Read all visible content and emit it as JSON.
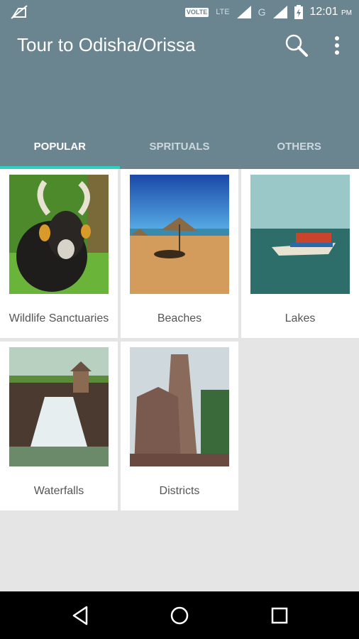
{
  "status_bar": {
    "volte": "VOLTE",
    "lte": "LTE",
    "network": "G",
    "time": "12:01",
    "ampm": "PM"
  },
  "app_bar": {
    "title": "Tour to Odisha/Orissa"
  },
  "tabs": [
    {
      "label": "POPULAR",
      "active": true
    },
    {
      "label": "SPRITUALS",
      "active": false
    },
    {
      "label": "OTHERS",
      "active": false
    }
  ],
  "categories": [
    {
      "label": "Wildlife Sanctuaries",
      "image": "bison-image"
    },
    {
      "label": "Beaches",
      "image": "beach-image"
    },
    {
      "label": "Lakes",
      "image": "lake-boat-image"
    },
    {
      "label": "Waterfalls",
      "image": "waterfall-image"
    },
    {
      "label": "Districts",
      "image": "temple-image"
    }
  ],
  "colors": {
    "primary": "#6a8590",
    "tab_indicator": "#2fd0c0",
    "background": "#e5e5e5"
  }
}
